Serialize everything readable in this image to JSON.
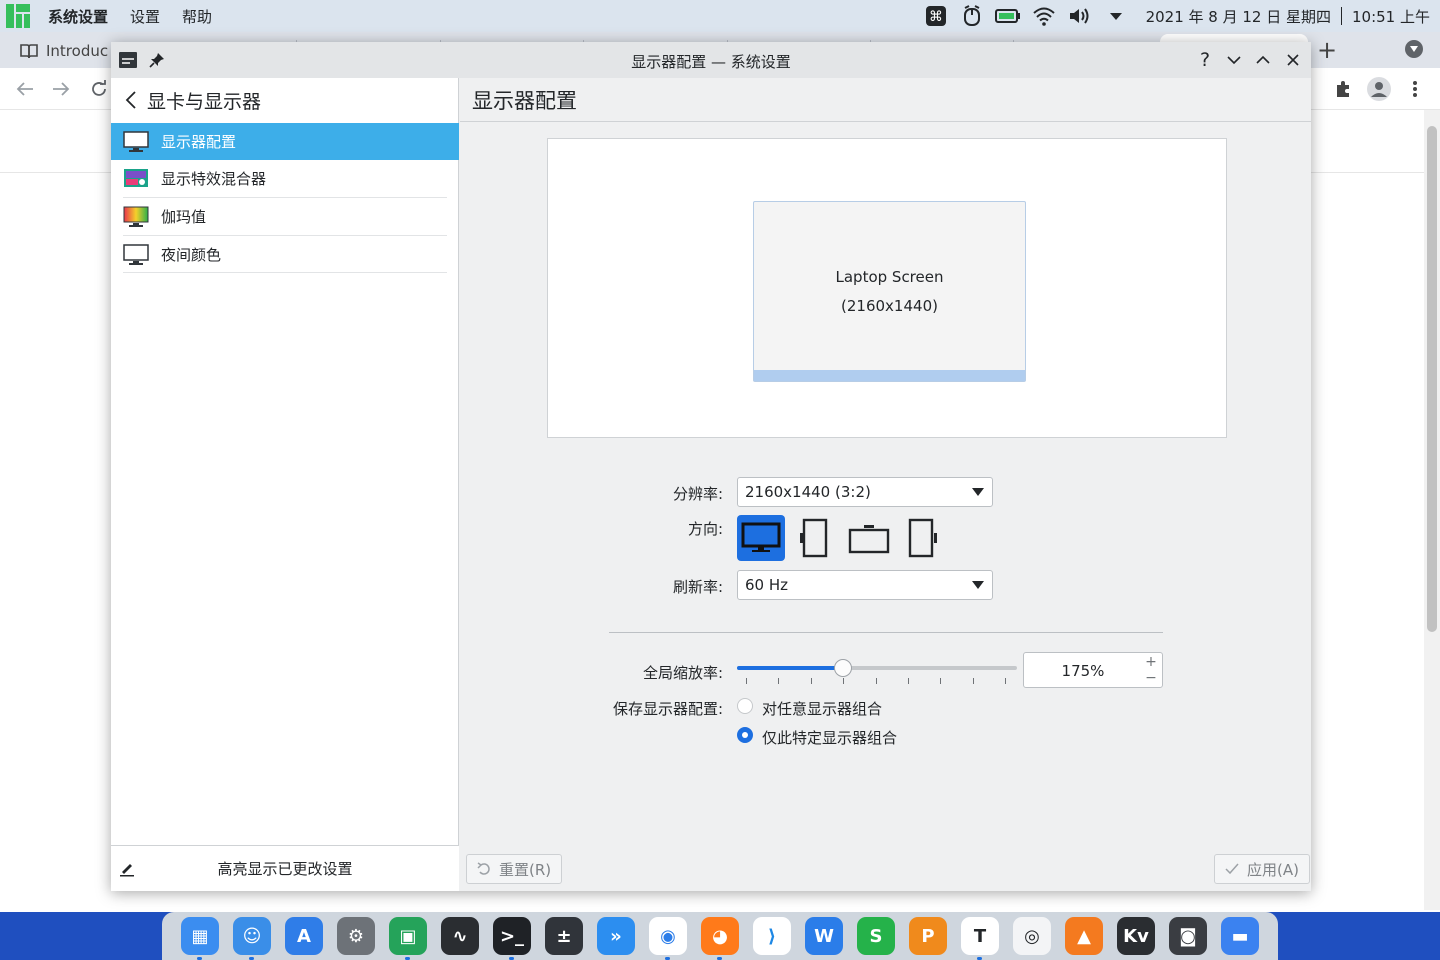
{
  "topbar": {
    "app_name": "系统设置",
    "menus": [
      "设置",
      "帮助"
    ],
    "clock": "2021 年 8 月 12 日 星期四",
    "time": "10:51 上午"
  },
  "browser": {
    "tab1_title": "Introduc"
  },
  "dialog": {
    "title": "显示器配置 — 系统设置",
    "sidebar": {
      "header": "显卡与显示器",
      "items": [
        {
          "label": "显示器配置"
        },
        {
          "label": "显示特效混合器"
        },
        {
          "label": "伽玛值"
        },
        {
          "label": "夜间颜色"
        }
      ],
      "footer": "高亮显示已更改设置"
    },
    "main": {
      "title": "显示器配置",
      "screen_name": "Laptop Screen",
      "screen_res": "(2160x1440)",
      "resolution_label": "分辨率:",
      "resolution_value": "2160x1440 (3:2)",
      "orientation_label": "方向:",
      "refresh_label": "刷新率:",
      "refresh_value": "60 Hz",
      "scale_label": "全局缩放率:",
      "scale_value": "175%",
      "scale_level": 0.38,
      "save_label": "保存显示器配置:",
      "save_options": [
        {
          "label": "对任意显示器组合",
          "checked": false
        },
        {
          "label": "仅此特定显示器组合",
          "checked": true
        }
      ],
      "reset_button": "重置(R)",
      "apply_button": "应用(A)"
    }
  },
  "dock": {
    "apps": [
      {
        "name": "launcher-icon",
        "color": "#3b8df0"
      },
      {
        "name": "finder-icon",
        "color": "#3a8ee8"
      },
      {
        "name": "app-store-icon",
        "color": "#2f7de8"
      },
      {
        "name": "settings-icon",
        "color": "#6d7278"
      },
      {
        "name": "system-monitor-icon",
        "color": "#25a35a"
      },
      {
        "name": "activity-icon",
        "color": "#2a2d31"
      },
      {
        "name": "terminal-icon",
        "color": "#1f2226"
      },
      {
        "name": "calculator-icon",
        "color": "#30343a"
      },
      {
        "name": "swift-icon",
        "color": "#2c8ef0"
      },
      {
        "name": "chrome-icon",
        "color": "#ffffff"
      },
      {
        "name": "firefox-icon",
        "color": "#ff7a1a"
      },
      {
        "name": "vscode-icon",
        "color": "#ffffff"
      },
      {
        "name": "wps-writer-icon",
        "color": "#2b7de9"
      },
      {
        "name": "wps-sheet-icon",
        "color": "#25b24a"
      },
      {
        "name": "wps-slide-icon",
        "color": "#f08a1c"
      },
      {
        "name": "typora-icon",
        "color": "#ffffff"
      },
      {
        "name": "preview-icon",
        "color": "#f3f4f6"
      },
      {
        "name": "vlc-icon",
        "color": "#f47a1f"
      },
      {
        "name": "kvantum-icon",
        "color": "#2a2d31"
      },
      {
        "name": "screenshot-icon",
        "color": "#3a3d42"
      },
      {
        "name": "folder-icon",
        "color": "#3b82f0"
      }
    ]
  }
}
